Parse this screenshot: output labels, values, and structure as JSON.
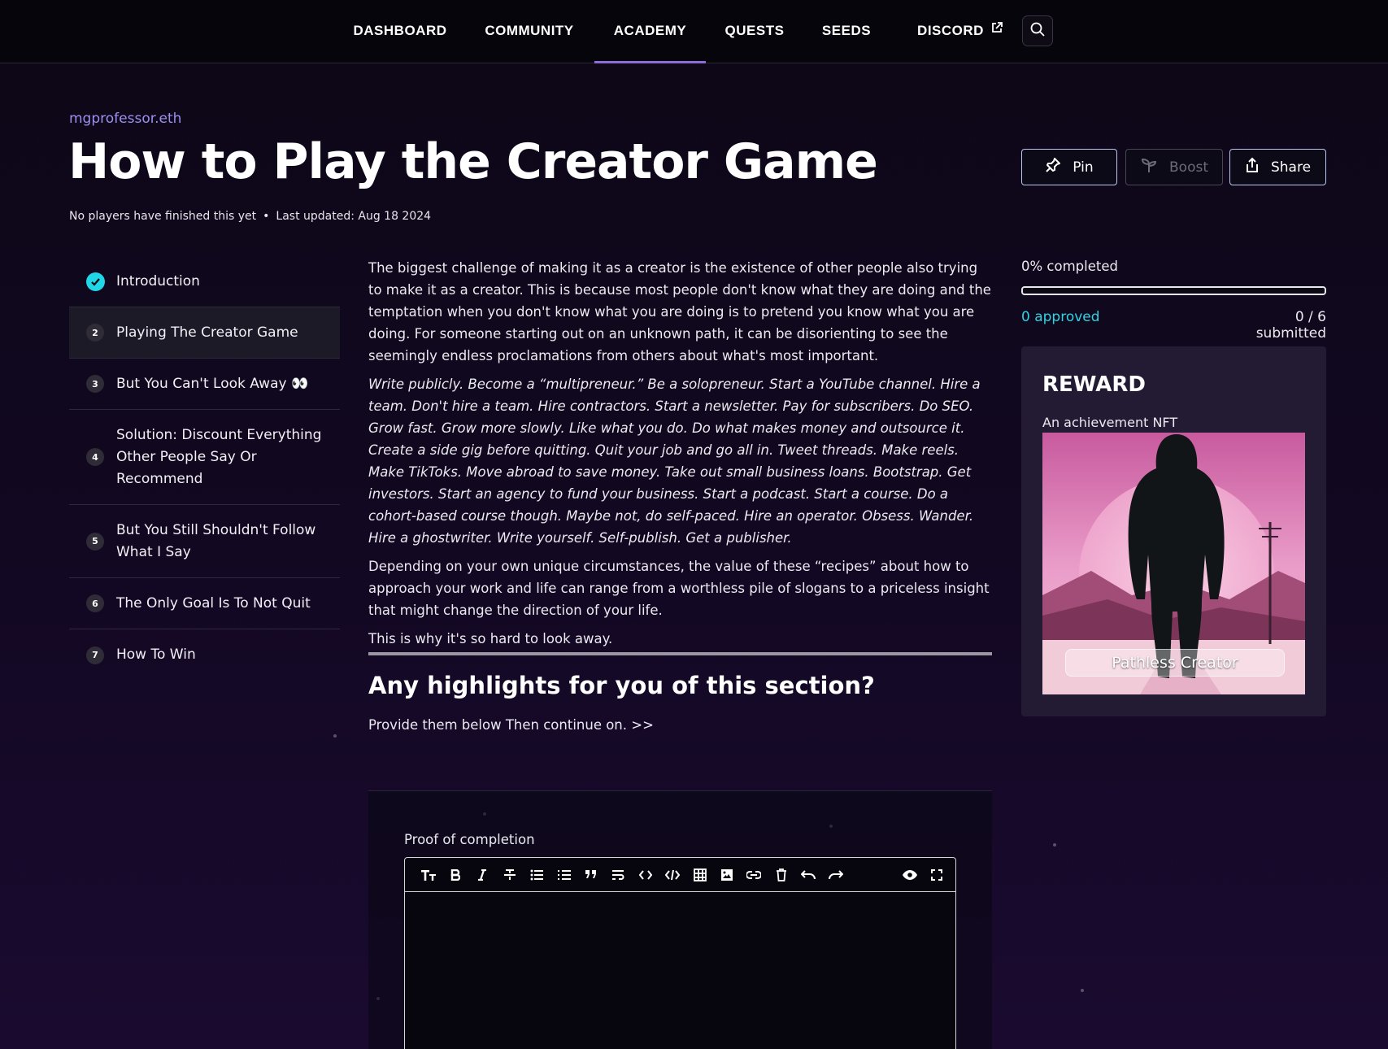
{
  "nav": {
    "items": [
      {
        "label": "DASHBOARD"
      },
      {
        "label": "COMMUNITY"
      },
      {
        "label": "ACADEMY",
        "active": true
      },
      {
        "label": "QUESTS"
      },
      {
        "label": "SEEDS"
      },
      {
        "label": "DISCORD",
        "external": true
      }
    ],
    "search_icon": "search-icon"
  },
  "header": {
    "author": "mgprofessor.eth",
    "title": "How to Play the Creator Game",
    "finished_text": "No players have finished this yet",
    "separator": "•",
    "last_updated": "Last updated: Aug 18 2024"
  },
  "actions": {
    "pin": "Pin",
    "boost": "Boost",
    "share": "Share"
  },
  "toc": [
    {
      "label": "Introduction",
      "completed": true
    },
    {
      "num": "2",
      "label": "Playing The Creator Game",
      "active": true
    },
    {
      "num": "3",
      "label": "But You Can't Look Away 👀"
    },
    {
      "num": "4",
      "label": "Solution: Discount Everything Other People Say Or Recommend"
    },
    {
      "num": "5",
      "label": "But You Still Shouldn't Follow What I Say"
    },
    {
      "num": "6",
      "label": "The Only Goal Is To Not Quit"
    },
    {
      "num": "7",
      "label": "How To Win"
    }
  ],
  "article": {
    "p1": "The biggest challenge of making it as a creator is the existence of other people also trying to make it as a creator. This is because most people don't know what they are doing and the temptation when you don't know what you are doing is to pretend you know what you are doing. For someone starting out on an unknown path, it can be disorienting to see the seemingly endless proclamations from others about what's most important.",
    "p2": "Write publicly. Become a “multipreneur.” Be a solopreneur. Start a YouTube channel. Hire a team. Don't hire a team. Hire contractors. Start a newsletter. Pay for subscribers. Do SEO. Grow fast. Grow more slowly. Like what you do. Do what makes money and outsource it. Create a side gig before quitting. Quit your job and go all in. Tweet threads. Make reels. Make TikToks. Move abroad to save money. Take out small business loans. Bootstrap. Get investors. Start an agency to fund your business. Start a podcast. Start a course. Do a cohort-based course though. Maybe not, do self-paced. Hire an operator. Obsess. Wander. Hire a ghostwriter. Write yourself. Self-publish. Get a publisher.",
    "p3": "Depending on your own unique circumstances, the value of these “recipes” about how to approach your work and life can range from a worthless pile of slogans to a priceless insight that might change the direction of your life.",
    "p4": "This is why it's so hard to look away."
  },
  "section": {
    "question": "Any highlights for you of this section?",
    "hint": "Provide them below Then continue on. >>"
  },
  "proof": {
    "label": "Proof of completion",
    "toolbar": [
      "heading-icon",
      "bold-icon",
      "italic-icon",
      "strikethrough-icon",
      "bullet-list-icon",
      "ordered-list-icon",
      "quote-icon",
      "hard-break-icon",
      "inline-code-icon",
      "code-block-icon",
      "table-icon",
      "image-icon",
      "link-icon",
      "delete-icon",
      "undo-icon",
      "redo-icon"
    ],
    "toolbar_right": [
      "preview-icon",
      "fullscreen-icon"
    ]
  },
  "progress": {
    "percent_label": "0% completed",
    "value": 0,
    "approved": "0 approved",
    "submitted": "0 / 6 submitted"
  },
  "reward": {
    "title": "REWARD",
    "subtitle": "An achievement NFT",
    "nft_label": "Pathless Creator"
  },
  "colors": {
    "accent_purple": "#9d8ff0",
    "active_tab_underline": "#8e6bd8",
    "cyan": "#21d6e6"
  }
}
